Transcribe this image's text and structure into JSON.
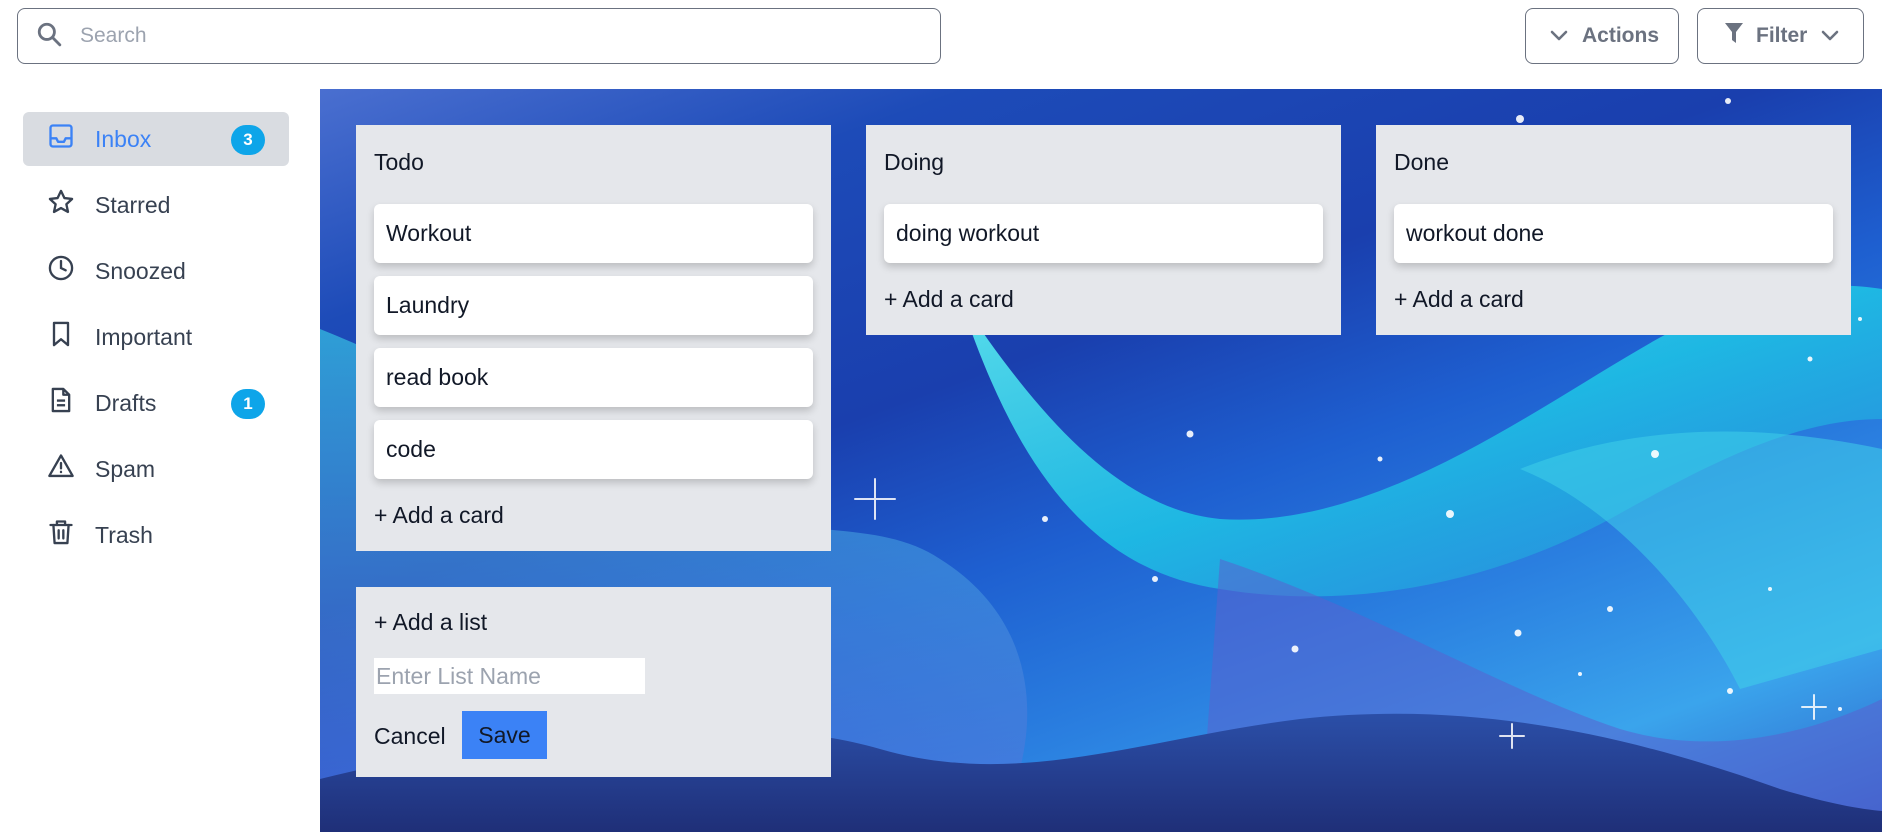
{
  "search": {
    "placeholder": "Search",
    "value": ""
  },
  "toolbar": {
    "actions_label": "Actions",
    "filter_label": "Filter"
  },
  "sidebar": {
    "items": [
      {
        "label": "Inbox",
        "icon": "inbox-icon",
        "badge": "3",
        "active": true
      },
      {
        "label": "Starred",
        "icon": "star-icon"
      },
      {
        "label": "Snoozed",
        "icon": "clock-icon"
      },
      {
        "label": "Important",
        "icon": "bookmark-icon"
      },
      {
        "label": "Drafts",
        "icon": "document-icon",
        "badge": "1"
      },
      {
        "label": "Spam",
        "icon": "warning-icon"
      },
      {
        "label": "Trash",
        "icon": "trash-icon"
      }
    ]
  },
  "board": {
    "lists": [
      {
        "title": "Todo",
        "cards": [
          "Workout",
          "Laundry",
          "read book",
          "code"
        ],
        "add_card": "+ Add a card"
      },
      {
        "title": "Doing",
        "cards": [
          "doing workout"
        ],
        "add_card": "+ Add a card"
      },
      {
        "title": "Done",
        "cards": [
          "workout done"
        ],
        "add_card": "+ Add a card"
      }
    ],
    "add_list": {
      "label": "+ Add a list",
      "input_placeholder": "Enter List Name",
      "cancel_label": "Cancel",
      "save_label": "Save"
    }
  },
  "colors": {
    "accent": "#3b82f6",
    "badge": "#0ea5e9",
    "active_bg": "#d9dce1",
    "list_bg": "#e5e7eb"
  }
}
